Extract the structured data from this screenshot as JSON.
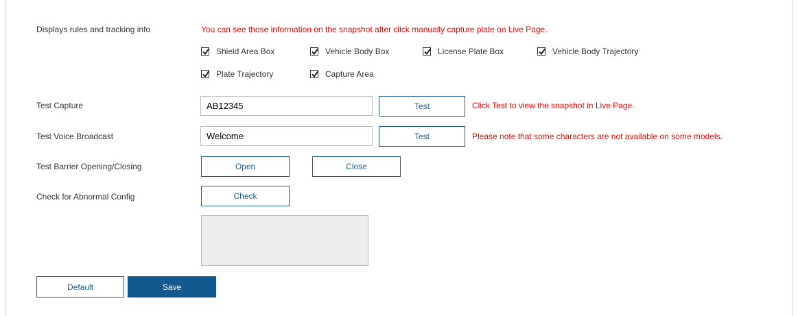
{
  "rules": {
    "label": "Displays rules and tracking info",
    "note": "You can see those information on the snapshot after click manually capture plate on Live Page.",
    "checkboxes": [
      {
        "label": "Shield Area Box",
        "checked": true
      },
      {
        "label": "Vehicle Body Box",
        "checked": true
      },
      {
        "label": "License Plate Box",
        "checked": true
      },
      {
        "label": "Vehicle Body Trajectory",
        "checked": true
      },
      {
        "label": "Plate Trajectory",
        "checked": true
      },
      {
        "label": "Capture Area",
        "checked": true
      }
    ]
  },
  "test_capture": {
    "label": "Test Capture",
    "value": "AB12345",
    "button": "Test",
    "note": "Click Test to view the snapshot in Live Page."
  },
  "voice_broadcast": {
    "label": "Test Voice Broadcast",
    "value": "Welcome",
    "button": "Test",
    "note": "Please note that some characters are not available on some models."
  },
  "barrier": {
    "label": "Test Barrier Opening/Closing",
    "open_button": "Open",
    "close_button": "Close"
  },
  "abnormal": {
    "label": "Check for Abnormal Config",
    "button": "Check"
  },
  "footer": {
    "default_button": "Default",
    "save_button": "Save"
  },
  "colors": {
    "note_red": "#ff0000",
    "accent_blue": "#11598f"
  }
}
